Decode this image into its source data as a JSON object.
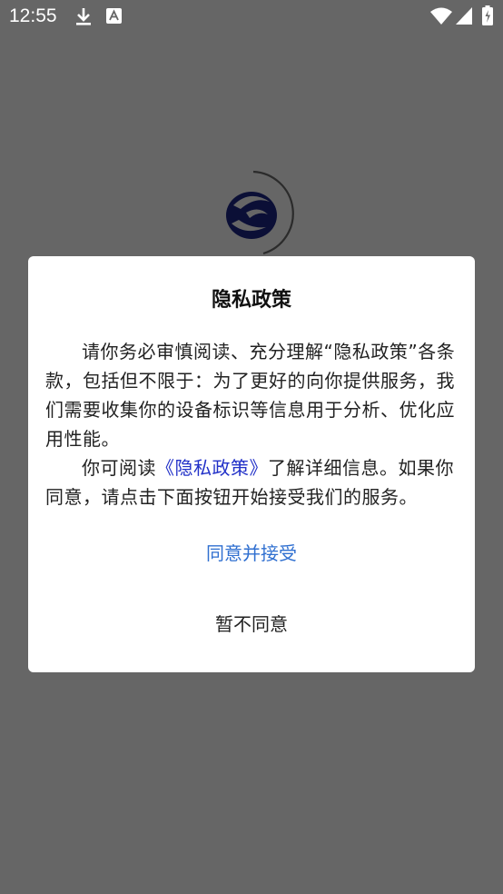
{
  "status_bar": {
    "time": "12:55",
    "left_icons": [
      "download-icon",
      "app-notification-icon"
    ],
    "right_icons": [
      "wifi-icon",
      "signal-icon",
      "battery-charging-icon"
    ],
    "icon_color": "#ffffff"
  },
  "background": {
    "scrim_color": "#666666",
    "logo_icon": "app-logo-icon",
    "spinner_icon": "loading-spinner-icon"
  },
  "dialog": {
    "title": "隐私政策",
    "paragraph1": "请你务必审慎阅读、充分理解“隐私政策”各条款，包括但不限于：为了更好的向你提供服务，我们需要收集你的设备标识等信息用于分析、优化应用性能。",
    "paragraph2_prefix": "你可阅读",
    "policy_link": "《隐私政策》",
    "paragraph2_suffix": "了解详细信息。如果你同意，请点击下面按钮开始接受我们的服务。",
    "accept_label": "同意并接受",
    "decline_label": "暂不同意",
    "link_color": "#2231c8",
    "accept_color": "#2f6fd0"
  }
}
